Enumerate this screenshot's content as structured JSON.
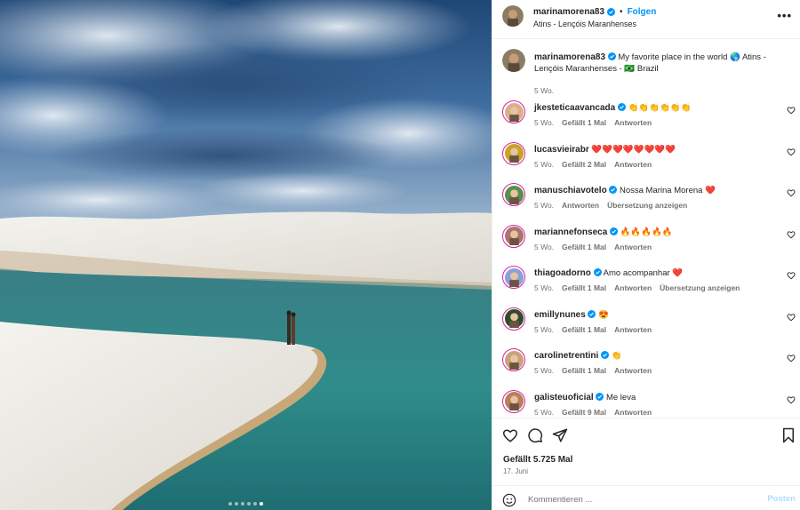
{
  "post": {
    "author": "marinamorena83",
    "follow_label": "Folgen",
    "separator": "•",
    "location": "Atins - Lençóis Maranhenses",
    "more_label": "•••",
    "slides_total": 6,
    "slide_active": 6
  },
  "caption": {
    "username": "marinamorena83",
    "text": "My favorite place in the world 🌎 Atins - Lençóis Maranhenses - 🇧🇷 Brazil",
    "time": "5 Wo."
  },
  "comments": [
    {
      "username": "jkesteticaavancada",
      "verified": true,
      "text": "👏👏👏👏👏👏",
      "time": "5 Wo.",
      "likes": "Gefällt 1 Mal",
      "reply": "Antworten",
      "translate": "",
      "avatar_color": "#d9b08c"
    },
    {
      "username": "lucasvieirabr",
      "verified": false,
      "text": "❤️❤️❤️❤️❤️❤️❤️❤️",
      "time": "5 Wo.",
      "likes": "Gefällt 2 Mal",
      "reply": "Antworten",
      "translate": "",
      "avatar_color": "#c9a227"
    },
    {
      "username": "manuschiavotelo",
      "verified": true,
      "text": "Nossa Marina Morena ❤️",
      "time": "5 Wo.",
      "likes": "",
      "reply": "Antworten",
      "translate": "Übersetzung anzeigen",
      "avatar_color": "#5a8f4e"
    },
    {
      "username": "mariannefonseca",
      "verified": true,
      "text": "🔥🔥🔥🔥🔥",
      "time": "5 Wo.",
      "likes": "Gefällt 1 Mal",
      "reply": "Antworten",
      "translate": "",
      "avatar_color": "#a9746e"
    },
    {
      "username": "thiagoadorno",
      "verified": true,
      "text": "Amo acompanhar ❤️",
      "time": "5 Wo.",
      "likes": "Gefällt 1 Mal",
      "reply": "Antworten",
      "translate": "Übersetzung anzeigen",
      "avatar_color": "#8f9fd8"
    },
    {
      "username": "emillynunes",
      "verified": true,
      "text": "😍",
      "time": "5 Wo.",
      "likes": "Gefällt 1 Mal",
      "reply": "Antworten",
      "translate": "",
      "avatar_color": "#2e4d2a"
    },
    {
      "username": "carolinetrentini",
      "verified": true,
      "text": "👏",
      "time": "5 Wo.",
      "likes": "Gefällt 1 Mal",
      "reply": "Antworten",
      "translate": "",
      "avatar_color": "#c8a37a"
    },
    {
      "username": "galisteuoficial",
      "verified": true,
      "text": "Me leva",
      "time": "5 Wo.",
      "likes": "Gefällt 9 Mal",
      "reply": "Antworten",
      "translate": "",
      "avatar_color": "#b8805a"
    }
  ],
  "stats": {
    "likes": "Gefällt 5.725 Mal",
    "date": "17. Juni"
  },
  "add_comment": {
    "placeholder": "Kommentieren ...",
    "post_label": "Posten"
  },
  "icons": [
    "heart-icon",
    "comment-icon",
    "share-icon",
    "bookmark-icon",
    "emoji-icon",
    "verified-icon",
    "more-icon"
  ],
  "colors": {
    "accent": "#0095f6",
    "post_disabled": "#b3dbff",
    "verified": "#0095f6",
    "muted": "#737373"
  }
}
